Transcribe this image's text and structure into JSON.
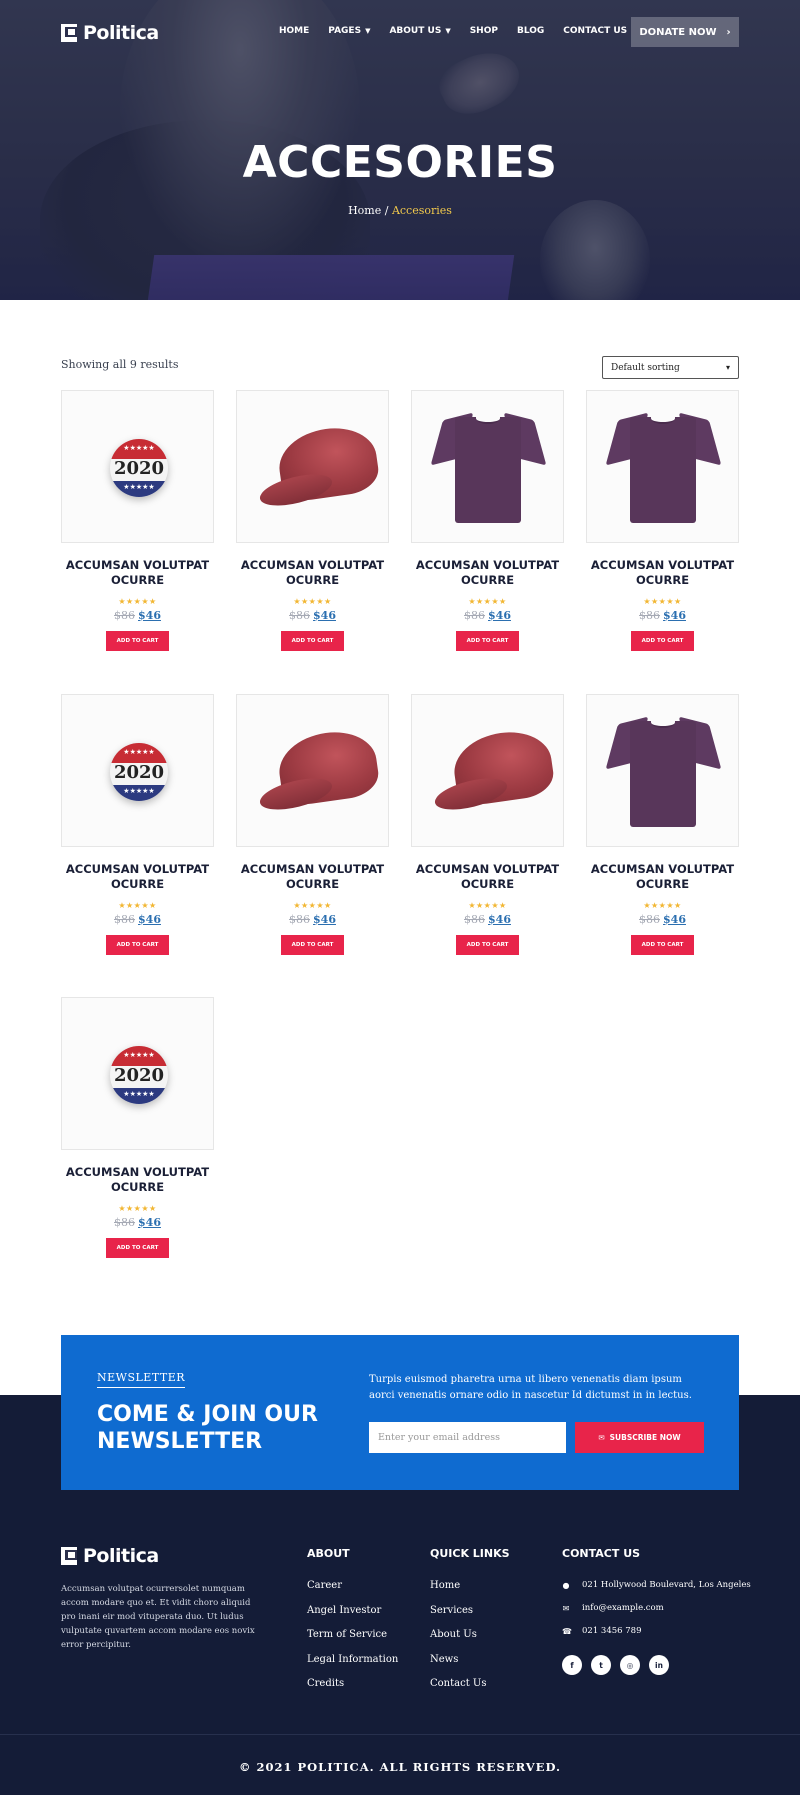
{
  "header": {
    "logo": "Politica",
    "nav": [
      {
        "label": "HOME",
        "dropdown": false
      },
      {
        "label": "PAGES",
        "dropdown": true
      },
      {
        "label": "ABOUT US",
        "dropdown": true
      },
      {
        "label": "SHOP",
        "dropdown": false
      },
      {
        "label": "BLOG",
        "dropdown": false
      },
      {
        "label": "CONTACT US",
        "dropdown": false
      }
    ],
    "donate_label": "DONATE NOW"
  },
  "hero": {
    "title": "ACCESORIES",
    "breadcrumb": {
      "home": "Home",
      "separator": "/",
      "current": "Accesories"
    }
  },
  "shop": {
    "results": "Showing all 9 results",
    "sort_selected": "Default sorting",
    "products": [
      {
        "name": "ACCUMSAN VOLUTPAT OCURRE",
        "image": "badge-2020",
        "old_price": "$86",
        "price": "$46",
        "stars": "★★★★★",
        "button": "ADD TO CART"
      },
      {
        "name": "ACCUMSAN VOLUTPAT OCURRE",
        "image": "red-cap",
        "old_price": "$86",
        "price": "$46",
        "stars": "★★★★★",
        "button": "ADD TO CART"
      },
      {
        "name": "ACCUMSAN VOLUTPAT OCURRE",
        "image": "purple-tshirt",
        "old_price": "$86",
        "price": "$46",
        "stars": "★★★★★",
        "button": "ADD TO CART"
      },
      {
        "name": "ACCUMSAN VOLUTPAT OCURRE",
        "image": "purple-tshirt",
        "old_price": "$86",
        "price": "$46",
        "stars": "★★★★★",
        "button": "ADD TO CART"
      },
      {
        "name": "ACCUMSAN VOLUTPAT OCURRE",
        "image": "badge-2020",
        "old_price": "$86",
        "price": "$46",
        "stars": "★★★★★",
        "button": "ADD TO CART"
      },
      {
        "name": "ACCUMSAN VOLUTPAT OCURRE",
        "image": "red-cap",
        "old_price": "$86",
        "price": "$46",
        "stars": "★★★★★",
        "button": "ADD TO CART"
      },
      {
        "name": "ACCUMSAN VOLUTPAT OCURRE",
        "image": "red-cap",
        "old_price": "$86",
        "price": "$46",
        "stars": "★★★★★",
        "button": "ADD TO CART"
      },
      {
        "name": "ACCUMSAN VOLUTPAT OCURRE",
        "image": "purple-tshirt",
        "old_price": "$86",
        "price": "$46",
        "stars": "★★★★★",
        "button": "ADD TO CART"
      },
      {
        "name": "ACCUMSAN VOLUTPAT OCURRE",
        "image": "badge-2020",
        "old_price": "$86",
        "price": "$46",
        "stars": "★★★★★",
        "button": "ADD TO CART"
      }
    ],
    "badge_year": "2020"
  },
  "newsletter": {
    "kicker": "NEWSLETTER",
    "title": "COME & JOIN OUR NEWSLETTER",
    "text": "Turpis euismod pharetra urna ut libero venenatis diam ipsum aorci venenatis ornare odio in nascetur Id dictumst in in lectus.",
    "placeholder": "Enter your email address",
    "button": "SUBSCRIBE NOW"
  },
  "footer": {
    "logo": "Politica",
    "about_text": "Accumsan volutpat ocurrersolet numquam accom modare quo et. Et vidit choro aliquid pro inani eir mod vituperata duo. Ut ludus vulputate quvartem accom modare eos novix error percipitur.",
    "about": {
      "title": "ABOUT",
      "links": [
        "Career",
        "Angel Investor",
        "Term of Service",
        "Legal Information",
        "Credits"
      ]
    },
    "quick_links": {
      "title": "QUICK LINKS",
      "links": [
        "Home",
        "Services",
        "About Us",
        "News",
        "Contact Us"
      ]
    },
    "contact": {
      "title": "CONTACT US",
      "address": "021 Hollywood Boulevard, Los Angeles",
      "email": "info@example.com",
      "phone": "021 3456 789"
    },
    "socials": [
      {
        "icon": "facebook-icon",
        "glyph": "f"
      },
      {
        "icon": "twitter-icon",
        "glyph": "t"
      },
      {
        "icon": "instagram-icon",
        "glyph": "◎"
      },
      {
        "icon": "linkedin-icon",
        "glyph": "in"
      }
    ],
    "copyright": "© 2021 POLITICA. ALL RIGHTS RESERVED."
  },
  "colors": {
    "accent": "#e8244a",
    "brand_blue": "#0f6bd0",
    "navy": "#141c37",
    "link_blue": "#2b6fb0",
    "star": "#f2b632"
  }
}
